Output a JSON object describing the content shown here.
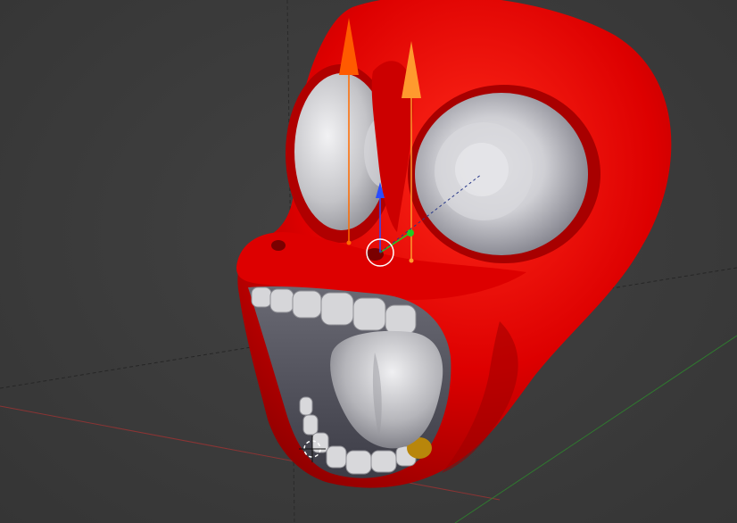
{
  "viewport": {
    "mode": "3d-viewport",
    "background_color": "#3d3d3d",
    "grid_line_color": "#2a2a2a"
  },
  "axes": {
    "x_color": "#9b3b3b",
    "y_color": "#3f8a3f",
    "z_color": "#3a5bd6"
  },
  "model": {
    "name": "red-cartoon-head",
    "skin_color": "#e20000",
    "eye_color": "#c9c9cc",
    "teeth_color": "#d8d8da",
    "tongue_color": "#b8b8bc",
    "gold_tooth_color": "#b8860b"
  },
  "gizmo": {
    "arrow_left_color": "#ff5a00",
    "arrow_right_color": "#ff9a2e",
    "z_handle_color": "#2a4cff",
    "y_handle_color": "#22cc22",
    "pivot_color": "#ffffff"
  },
  "cursor": {
    "icon": "3d-cursor-icon"
  }
}
